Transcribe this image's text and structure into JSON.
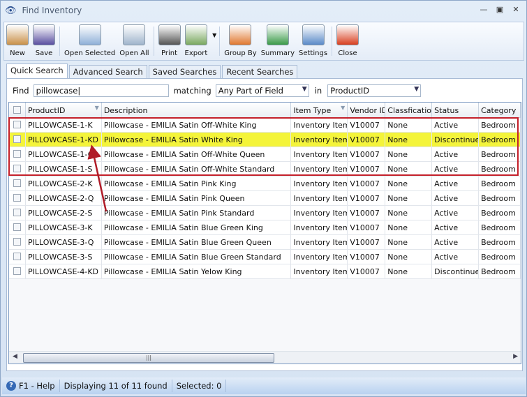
{
  "window": {
    "title": "Find Inventory",
    "icon": "binoculars-icon"
  },
  "toolbar": [
    {
      "label": "New",
      "icon": "new-box-icon",
      "color": "#c9914a"
    },
    {
      "label": "Save",
      "icon": "floppy-disk-icon",
      "color": "#5a4fa0"
    },
    {
      "label": "Open Selected",
      "icon": "open-selected-icon",
      "color": "#8fb0d8"
    },
    {
      "label": "Open All",
      "icon": "open-all-icon",
      "color": "#9fb4cc"
    },
    {
      "label": "Print",
      "icon": "printer-icon",
      "color": "#555"
    },
    {
      "label": "Export",
      "icon": "export-icon",
      "color": "#7aa860"
    },
    {
      "label": "Group By",
      "icon": "group-by-icon",
      "color": "#e07830"
    },
    {
      "label": "Summary",
      "icon": "summary-icon",
      "color": "#3a9a48"
    },
    {
      "label": "Settings",
      "icon": "settings-icon",
      "color": "#5a8ac8"
    },
    {
      "label": "Close",
      "icon": "close-window-icon",
      "color": "#d84020"
    }
  ],
  "tabs": [
    "Quick Search",
    "Advanced Search",
    "Saved Searches",
    "Recent Searches"
  ],
  "search": {
    "find_label": "Find",
    "find_value": "pillowcase",
    "matching_label": "matching",
    "matching_value": "Any Part of Field",
    "in_label": "in",
    "in_value": "ProductID"
  },
  "grid": {
    "columns": [
      "ProductID",
      "Description",
      "Item Type",
      "Vendor ID",
      "Classfication",
      "Status",
      "Category"
    ],
    "rows": [
      [
        "PILLOWCASE-1-K",
        "Pillowcase - EMILIA Satin Off-White King",
        "Inventory Item",
        "V10007",
        "None",
        "Active",
        "Bedroom"
      ],
      [
        "PILLOWCASE-1-KD",
        "Pillowcase - EMILIA Satin White King",
        "Inventory Item",
        "V10007",
        "None",
        "Discontinued",
        "Bedroom"
      ],
      [
        "PILLOWCASE-1-Q",
        "Pillowcase - EMILIA Satin Off-White Queen",
        "Inventory Item",
        "V10007",
        "None",
        "Active",
        "Bedroom"
      ],
      [
        "PILLOWCASE-1-S",
        "Pillowcase - EMILIA Satin Off-White Standard",
        "Inventory Item",
        "V10007",
        "None",
        "Active",
        "Bedroom"
      ],
      [
        "PILLOWCASE-2-K",
        "Pillowcase - EMILIA Satin Pink King",
        "Inventory Item",
        "V10007",
        "None",
        "Active",
        "Bedroom"
      ],
      [
        "PILLOWCASE-2-Q",
        "Pillowcase - EMILIA Satin Pink Queen",
        "Inventory Item",
        "V10007",
        "None",
        "Active",
        "Bedroom"
      ],
      [
        "PILLOWCASE-2-S",
        "Pillowcase - EMILIA Satin Pink Standard",
        "Inventory Item",
        "V10007",
        "None",
        "Active",
        "Bedroom"
      ],
      [
        "PILLOWCASE-3-K",
        "Pillowcase - EMILIA Satin Blue Green King",
        "Inventory Item",
        "V10007",
        "None",
        "Active",
        "Bedroom"
      ],
      [
        "PILLOWCASE-3-Q",
        "Pillowcase - EMILIA Satin Blue Green Queen",
        "Inventory Item",
        "V10007",
        "None",
        "Active",
        "Bedroom"
      ],
      [
        "PILLOWCASE-3-S",
        "Pillowcase - EMILIA Satin Blue Green Standard",
        "Inventory Item",
        "V10007",
        "None",
        "Active",
        "Bedroom"
      ],
      [
        "PILLOWCASE-4-KD",
        "Pillowcase - EMILIA Satin Yelow King",
        "Inventory Item",
        "V10007",
        "None",
        "Discontinued",
        "Bedroom"
      ]
    ],
    "highlighted_row": 1,
    "highlight_color": "#f4f43a",
    "annotation_color": "#c4202a"
  },
  "status": {
    "help": "F1 - Help",
    "displaying": "Displaying 11 of 11 found",
    "selected": "Selected: 0"
  }
}
